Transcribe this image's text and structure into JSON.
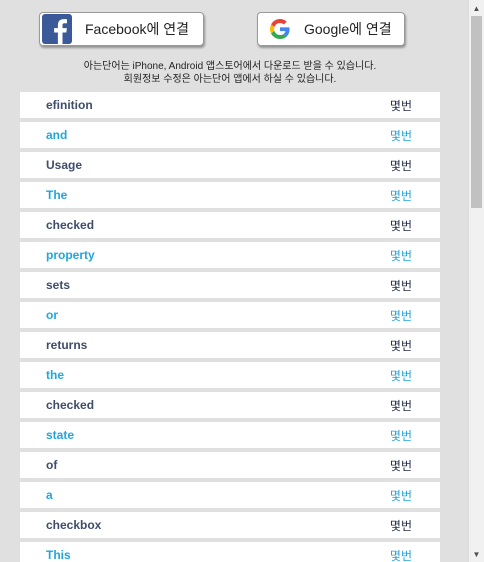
{
  "connect": {
    "facebook_label": "Facebook에 연결",
    "google_label": "Google에 연결"
  },
  "notice": {
    "line1": "아는단어는 iPhone, Android 앱스토어에서 다운로드 받을 수 있습니다.",
    "line2": "회원정보 수정은 아는단어 앱에서 하실 수 있습니다."
  },
  "words": [
    {
      "word": "efinition",
      "count": "몇번"
    },
    {
      "word": "and",
      "count": "몇번"
    },
    {
      "word": "Usage",
      "count": "몇번"
    },
    {
      "word": "The",
      "count": "몇번"
    },
    {
      "word": "checked",
      "count": "몇번"
    },
    {
      "word": "property",
      "count": "몇번"
    },
    {
      "word": "sets",
      "count": "몇번"
    },
    {
      "word": "or",
      "count": "몇번"
    },
    {
      "word": "returns",
      "count": "몇번"
    },
    {
      "word": "the",
      "count": "몇번"
    },
    {
      "word": "checked",
      "count": "몇번"
    },
    {
      "word": "state",
      "count": "몇번"
    },
    {
      "word": "of",
      "count": "몇번"
    },
    {
      "word": "a",
      "count": "몇번"
    },
    {
      "word": "checkbox",
      "count": "몇번"
    },
    {
      "word": "This",
      "count": "몇번"
    }
  ],
  "colors": {
    "odd_word": "#3d4d6b",
    "even_word": "#21a6dc",
    "facebook_blue": "#3b5998"
  },
  "icons": {
    "facebook": "facebook-icon",
    "google": "google-icon"
  }
}
